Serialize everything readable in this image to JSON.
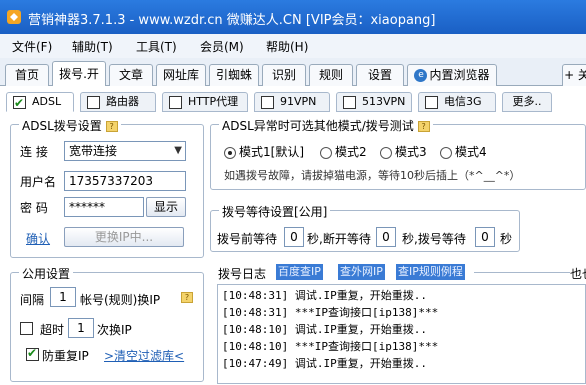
{
  "window": {
    "title": "营销神器3.7.1.3 - www.wzdr.cn 微赚达人.CN [VIP会员：xiaopang]"
  },
  "menu": [
    "文件(F)",
    "辅助(T)",
    "工具(T)",
    "会员(M)",
    "帮助(H)"
  ],
  "top_tabs": [
    "首页",
    "拨号.开",
    "文章",
    "网址库",
    "引蜘蛛",
    "识别",
    "规则",
    "设置",
    "内置浏览器",
    "+ 关"
  ],
  "sub_tabs": [
    "ADSL",
    "路由器",
    "HTTP代理",
    "91VPN",
    "513VPN",
    "电信3G",
    "更多.."
  ],
  "adsl": {
    "legend": "ADSL拨号设置",
    "conn_label": "连  接",
    "conn_value": "宽带连接",
    "user_label": "用户名",
    "user_value": "17357337203",
    "pwd_label": "密  码",
    "pwd_value": "******",
    "show_btn": "显示",
    "confirm_link": "确认",
    "change_ip_btn": "更换IP中..."
  },
  "mode": {
    "legend": "ADSL异常时可选其他模式/拨号测试",
    "options": [
      "模式1[默认]",
      "模式2",
      "模式3",
      "模式4"
    ],
    "hint": "如遇拨号故障，请拔掉猫电源，等待10秒后插上（*^__^*）"
  },
  "wait": {
    "legend": "拨号等待设置[公用]",
    "before_label": "拨号前等待",
    "before_value": "0",
    "unit1": "秒,断开等待",
    "disconnect_value": "0",
    "unit2": "秒,拨号等待",
    "dial_value": "0",
    "unit3": "秒"
  },
  "common": {
    "legend": "公用设置",
    "interval_label": "间隔",
    "interval_value": "1",
    "interval_suffix": "帐号(规则)换IP",
    "timeout_label": "超时",
    "timeout_value": "1",
    "timeout_suffix": "次换IP",
    "dup_label": "防重复IP",
    "clear_link": ">清空过滤库<"
  },
  "log": {
    "title": "拨号日志",
    "links": [
      "百度查IP",
      "查外网IP",
      "查IP规则例程"
    ],
    "right_text": "也也",
    "lines": [
      "[10:48:31] 调试.IP重复，开始重拨..",
      "[10:48:31] ***IP查询接口[ip138]***",
      "[10:48:10] 调试.IP重复，开始重拨..",
      "[10:48:10] ***IP查询接口[ip138]***",
      "[10:47:49] 调试.IP重复，开始重拨.."
    ]
  }
}
